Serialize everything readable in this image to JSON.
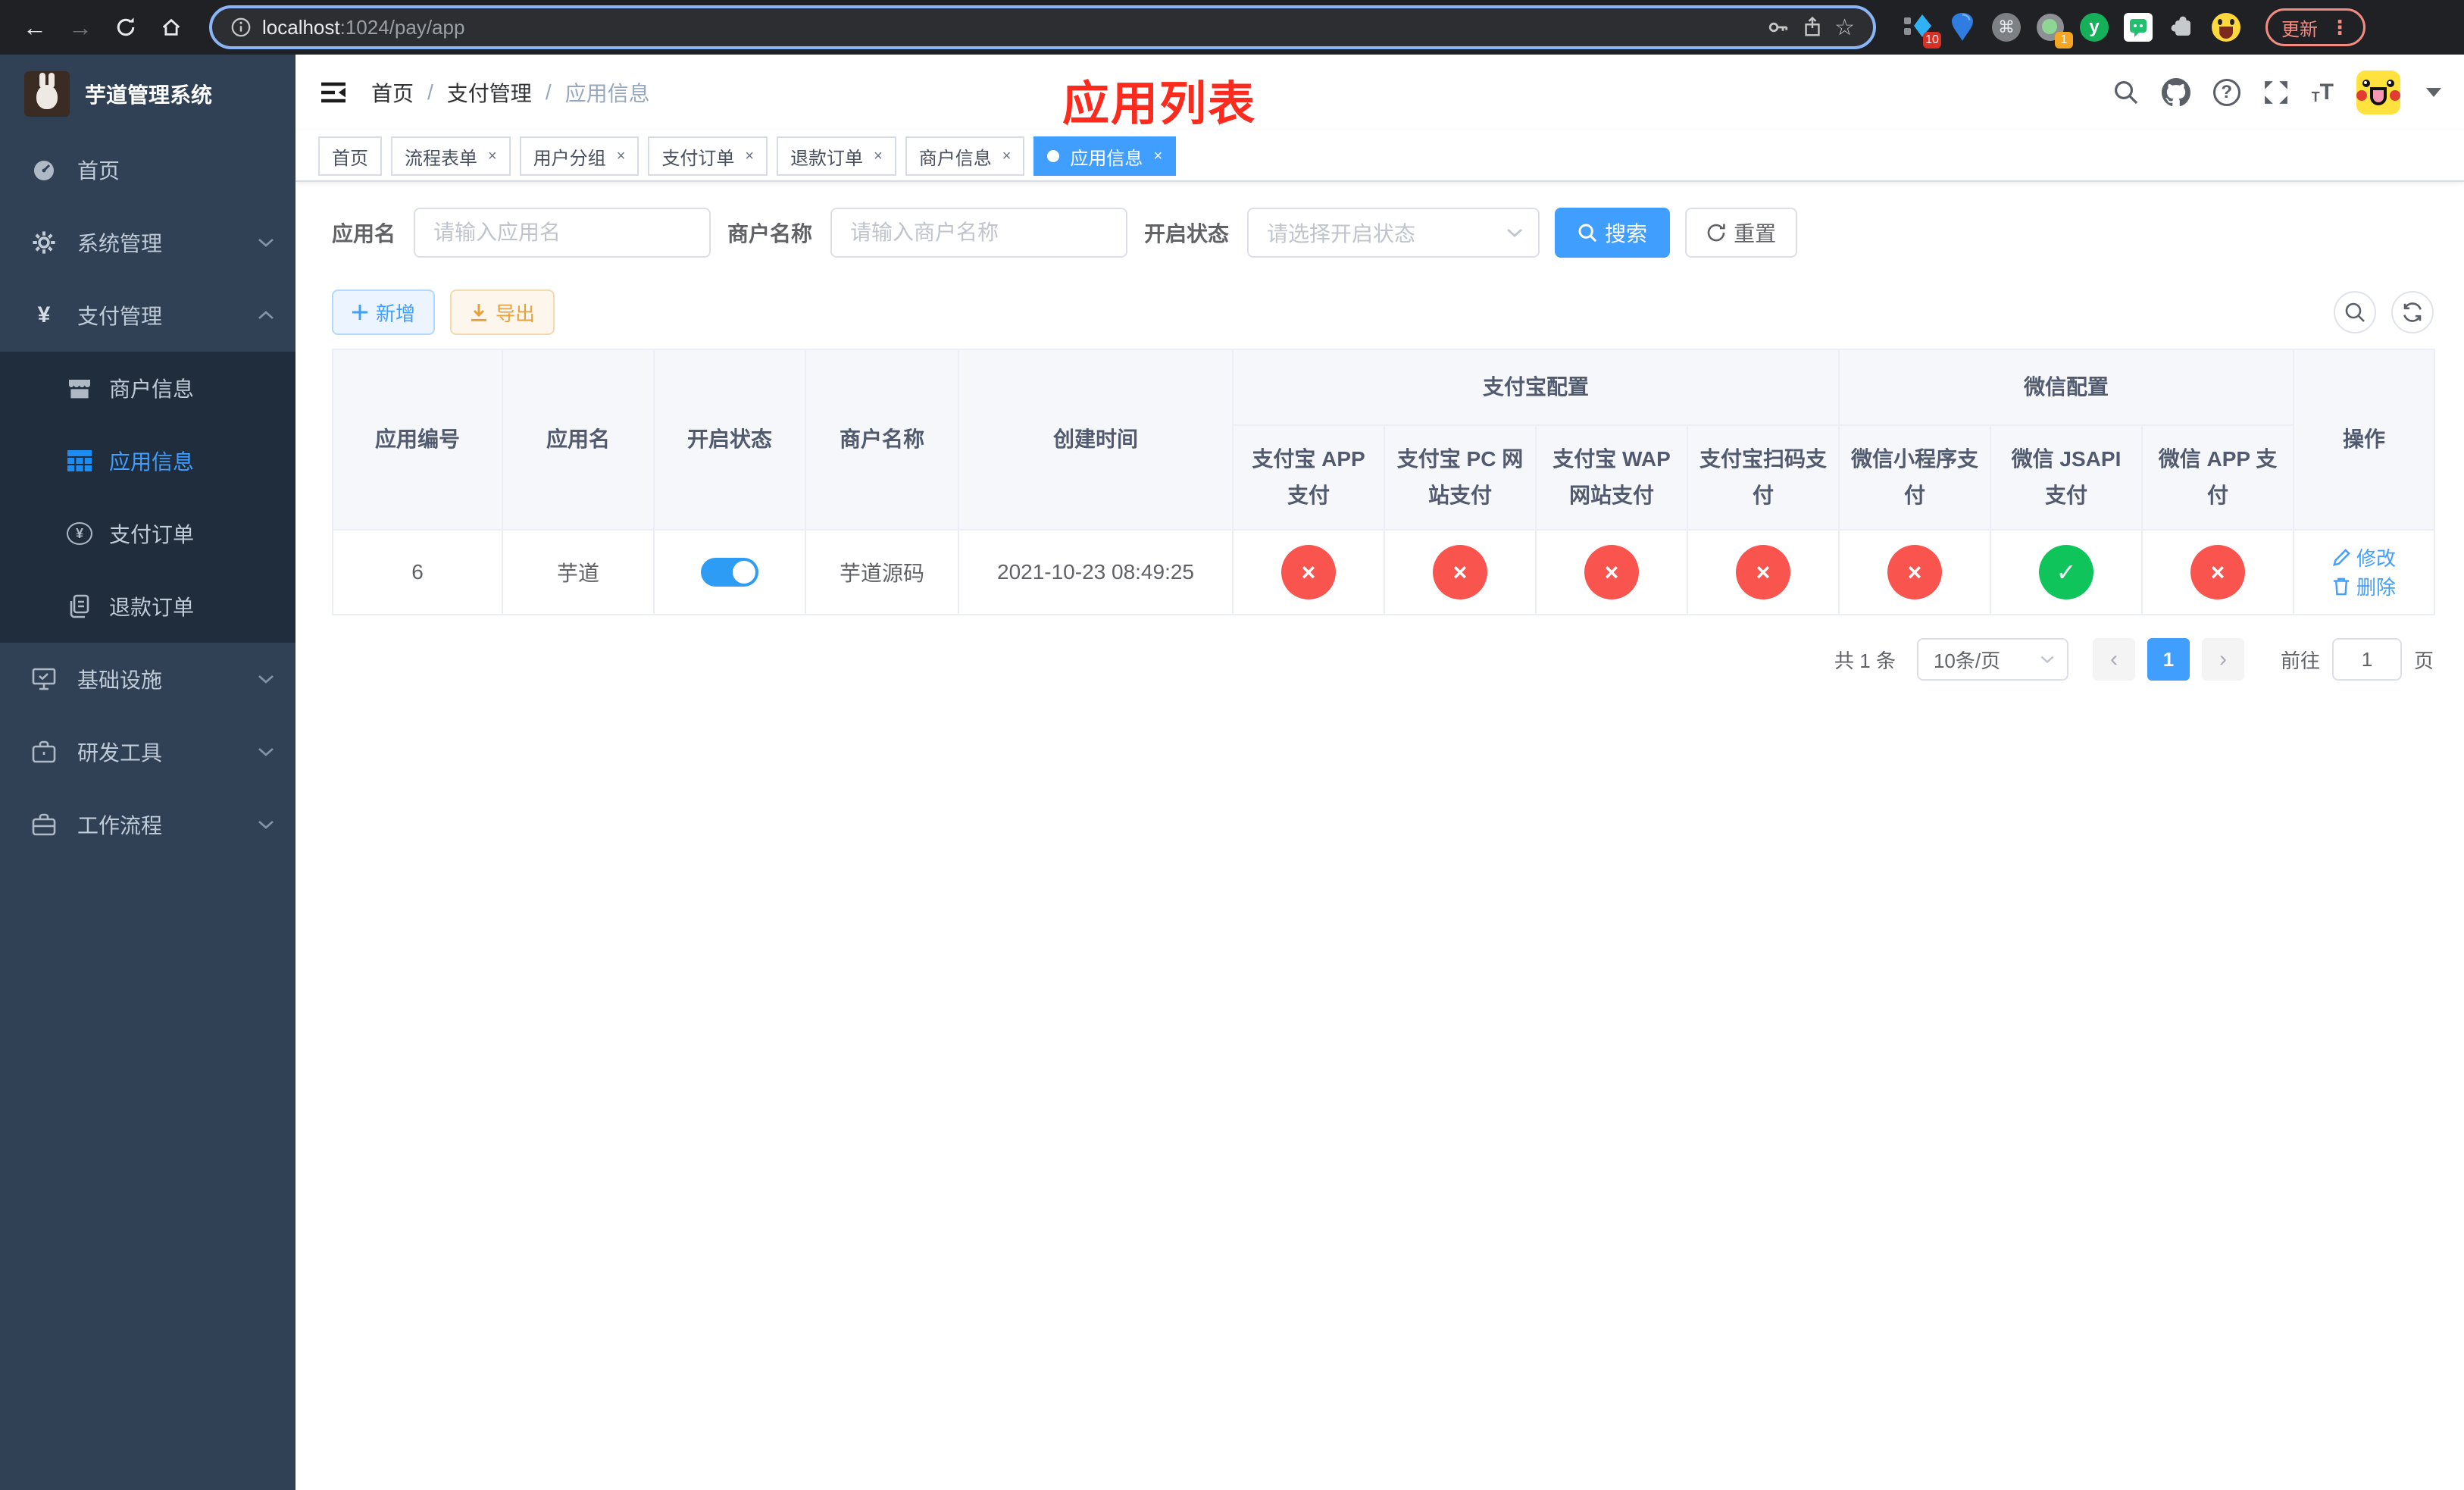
{
  "browser": {
    "url_host": "localhost",
    "url_rest": ":1024/pay/app",
    "update_label": "更新",
    "badge_10": "10",
    "badge_1": "1"
  },
  "icons": {
    "back": "←",
    "forward": "→",
    "star": "☆",
    "cmd": "⌘",
    "more": "⋮",
    "yen": "¥",
    "help": "?",
    "yuque": "y",
    "font_small": "T",
    "font_big": "T",
    "prev": "‹",
    "next": "›",
    "check": "✓",
    "cross": "×"
  },
  "sidebar": {
    "title": "芋道管理系统",
    "items": [
      {
        "label": "首页"
      },
      {
        "label": "系统管理"
      },
      {
        "label": "支付管理",
        "children": [
          {
            "label": "商户信息"
          },
          {
            "label": "应用信息"
          },
          {
            "label": "支付订单"
          },
          {
            "label": "退款订单"
          }
        ]
      },
      {
        "label": "基础设施"
      },
      {
        "label": "研发工具"
      },
      {
        "label": "工作流程"
      }
    ]
  },
  "navbar": {
    "breadcrumb": [
      "首页",
      "支付管理",
      "应用信息"
    ]
  },
  "annotation": "应用列表",
  "tabs": [
    {
      "label": "首页"
    },
    {
      "label": "流程表单"
    },
    {
      "label": "用户分组"
    },
    {
      "label": "支付订单"
    },
    {
      "label": "退款订单"
    },
    {
      "label": "商户信息"
    },
    {
      "label": "应用信息"
    }
  ],
  "filter": {
    "name_label": "应用名",
    "name_placeholder": "请输入应用名",
    "merchant_label": "商户名称",
    "merchant_placeholder": "请输入商户名称",
    "status_label": "开启状态",
    "status_placeholder": "请选择开启状态",
    "search_label": "搜索",
    "reset_label": "重置"
  },
  "toolbar": {
    "add_label": "新增",
    "export_label": "导出"
  },
  "table": {
    "headers": {
      "id": "应用编号",
      "name": "应用名",
      "enabled": "开启状态",
      "merchant": "商户名称",
      "created": "创建时间",
      "alipay_group": "支付宝配置",
      "wechat_group": "微信配置",
      "actions": "操作"
    },
    "sub_headers": [
      "支付宝 APP 支付",
      "支付宝 PC 网站支付",
      "支付宝 WAP 网站支付",
      "支付宝扫码支付",
      "微信小程序支付",
      "微信 JSAPI 支付",
      "微信 APP 支付"
    ],
    "row": {
      "id": "6",
      "name": "芋道",
      "enabled": true,
      "merchant": "芋道源码",
      "created": "2021-10-23 08:49:25",
      "pay_statuses": [
        false,
        false,
        false,
        false,
        false,
        true,
        false
      ]
    },
    "actions": {
      "edit": "修改",
      "delete": "删除"
    }
  },
  "pagination": {
    "total": "共 1 条",
    "size": "10条/页",
    "page": "1",
    "goto_label": "前往",
    "goto_value": "1",
    "unit": "页"
  },
  "colors": {
    "accent": "#409eff",
    "danger": "#f9544e",
    "success": "#10c45c",
    "sidebar_bg": "#304156",
    "submenu_bg": "#1f2d3d",
    "annotation": "#fd2a1e"
  }
}
